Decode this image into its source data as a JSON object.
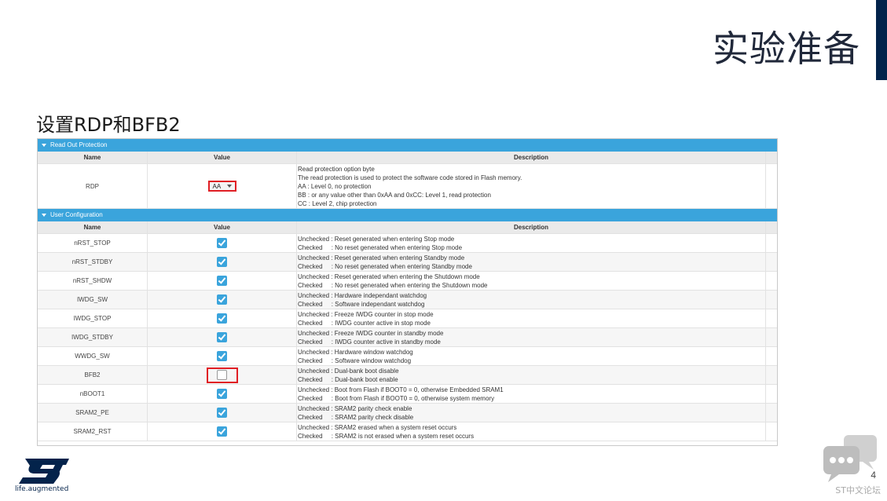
{
  "slide": {
    "title": "实验准备",
    "subtitle": "设置RDP和BFB2",
    "page_number": "4"
  },
  "logo": {
    "tagline": "life.augmented"
  },
  "forum": {
    "label": "ST中文论坛"
  },
  "colors": {
    "section_blue": "#3aa4dc",
    "highlight_red": "#e01e24",
    "brand_navy": "#03234b"
  },
  "read_out": {
    "section_label": "Read Out Protection",
    "headers": {
      "name": "Name",
      "value": "Value",
      "description": "Description"
    },
    "rdp": {
      "name": "RDP",
      "value": "AA",
      "desc": [
        "Read protection option byte",
        "The read protection is used to protect the software code stored in Flash memory.",
        "AA : Level 0, no protection",
        "BB : or any value other than 0xAA and 0xCC: Level 1, read protection",
        "CC : Level 2, chip protection"
      ]
    }
  },
  "user_config": {
    "section_label": "User Configuration",
    "headers": {
      "name": "Name",
      "value": "Value",
      "description": "Description"
    },
    "items": [
      {
        "name": "nRST_STOP",
        "checked": true,
        "d1": "Unchecked : Reset generated when entering Stop mode",
        "d2": "Checked     : No reset generated when entering Stop mode"
      },
      {
        "name": "nRST_STDBY",
        "checked": true,
        "d1": "Unchecked : Reset generated when entering Standby mode",
        "d2": "Checked     : No reset generated when entering Standby mode"
      },
      {
        "name": "nRST_SHDW",
        "checked": true,
        "d1": "Unchecked : Reset generated when entering the Shutdown mode",
        "d2": "Checked     : No reset generated when entering the Shutdown mode"
      },
      {
        "name": "IWDG_SW",
        "checked": true,
        "d1": "Unchecked : Hardware independant watchdog",
        "d2": "Checked     : Software independant watchdog"
      },
      {
        "name": "IWDG_STOP",
        "checked": true,
        "d1": "Unchecked : Freeze IWDG counter in stop mode",
        "d2": "Checked     : IWDG counter active in stop mode"
      },
      {
        "name": "IWDG_STDBY",
        "checked": true,
        "d1": "Unchecked : Freeze IWDG counter in standby mode",
        "d2": "Checked     : IWDG counter active in standby mode"
      },
      {
        "name": "WWDG_SW",
        "checked": true,
        "d1": "Unchecked : Hardware window watchdog",
        "d2": "Checked     : Software window watchdog"
      },
      {
        "name": "BFB2",
        "checked": false,
        "highlight": true,
        "d1": "Unchecked : Dual-bank boot disable",
        "d2": "Checked     : Dual-bank boot enable"
      },
      {
        "name": "nBOOT1",
        "checked": true,
        "d1": "Unchecked : Boot from Flash if BOOT0 = 0, otherwise Embedded SRAM1",
        "d2": "Checked     : Boot from Flash if BOOT0 = 0, otherwise system memory"
      },
      {
        "name": "SRAM2_PE",
        "checked": true,
        "d1": "Unchecked : SRAM2 parity check enable",
        "d2": "Checked     : SRAM2 parity check disable"
      },
      {
        "name": "SRAM2_RST",
        "checked": true,
        "d1": "Unchecked : SRAM2 erased when a system reset occurs",
        "d2": "Checked     : SRAM2 is not erased when a system reset occurs"
      }
    ]
  }
}
